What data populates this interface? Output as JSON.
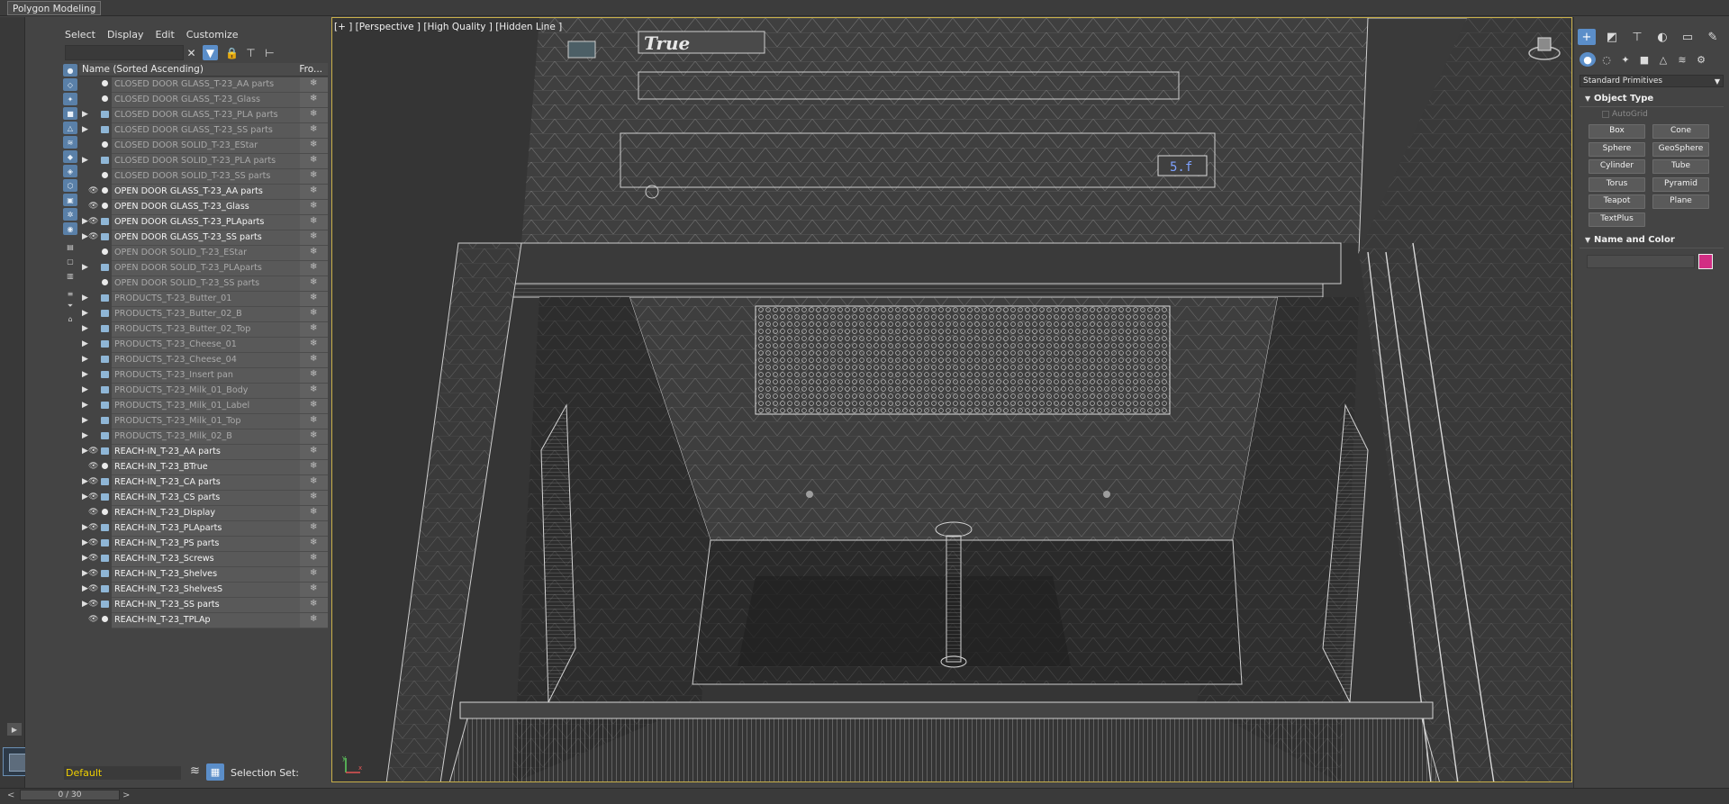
{
  "ribbon": {
    "active_tab": "Polygon Modeling"
  },
  "explorer": {
    "menu": [
      "Select",
      "Display",
      "Edit",
      "Customize"
    ],
    "header": {
      "name_col": "Name (Sorted Ascending)",
      "frozen_col": "Fro..."
    },
    "items": [
      {
        "label": "CLOSED DOOR GLASS_T-23_AA parts",
        "hidden": true,
        "group": false,
        "expand": false
      },
      {
        "label": "CLOSED DOOR GLASS_T-23_Glass",
        "hidden": true,
        "group": false,
        "expand": false
      },
      {
        "label": "CLOSED DOOR GLASS_T-23_PLA parts",
        "hidden": true,
        "group": true,
        "expand": true
      },
      {
        "label": "CLOSED DOOR GLASS_T-23_SS parts",
        "hidden": true,
        "group": true,
        "expand": true
      },
      {
        "label": "CLOSED DOOR SOLID_T-23_EStar",
        "hidden": true,
        "group": false,
        "expand": false
      },
      {
        "label": "CLOSED DOOR SOLID_T-23_PLA parts",
        "hidden": true,
        "group": true,
        "expand": true
      },
      {
        "label": "CLOSED DOOR SOLID_T-23_SS parts",
        "hidden": true,
        "group": false,
        "expand": false
      },
      {
        "label": "OPEN DOOR GLASS_T-23_AA parts",
        "hidden": false,
        "group": false,
        "expand": false
      },
      {
        "label": "OPEN DOOR GLASS_T-23_Glass",
        "hidden": false,
        "group": false,
        "expand": false
      },
      {
        "label": "OPEN DOOR GLASS_T-23_PLAparts",
        "hidden": false,
        "group": true,
        "expand": true
      },
      {
        "label": "OPEN DOOR GLASS_T-23_SS parts",
        "hidden": false,
        "group": true,
        "expand": true
      },
      {
        "label": "OPEN DOOR SOLID_T-23_EStar",
        "hidden": true,
        "group": false,
        "expand": false
      },
      {
        "label": "OPEN DOOR SOLID_T-23_PLAparts",
        "hidden": true,
        "group": true,
        "expand": true
      },
      {
        "label": "OPEN DOOR SOLID_T-23_SS parts",
        "hidden": true,
        "group": false,
        "expand": false
      },
      {
        "label": "PRODUCTS_T-23_Butter_01",
        "hidden": true,
        "group": true,
        "expand": true
      },
      {
        "label": "PRODUCTS_T-23_Butter_02_B",
        "hidden": true,
        "group": true,
        "expand": true
      },
      {
        "label": "PRODUCTS_T-23_Butter_02_Top",
        "hidden": true,
        "group": true,
        "expand": true
      },
      {
        "label": "PRODUCTS_T-23_Cheese_01",
        "hidden": true,
        "group": true,
        "expand": true
      },
      {
        "label": "PRODUCTS_T-23_Cheese_04",
        "hidden": true,
        "group": true,
        "expand": true
      },
      {
        "label": "PRODUCTS_T-23_Insert pan",
        "hidden": true,
        "group": true,
        "expand": true
      },
      {
        "label": "PRODUCTS_T-23_Milk_01_Body",
        "hidden": true,
        "group": true,
        "expand": true
      },
      {
        "label": "PRODUCTS_T-23_Milk_01_Label",
        "hidden": true,
        "group": true,
        "expand": true
      },
      {
        "label": "PRODUCTS_T-23_Milk_01_Top",
        "hidden": true,
        "group": true,
        "expand": true
      },
      {
        "label": "PRODUCTS_T-23_Milk_02_B",
        "hidden": true,
        "group": true,
        "expand": true
      },
      {
        "label": "REACH-IN_T-23_AA parts",
        "hidden": false,
        "group": true,
        "expand": true
      },
      {
        "label": "REACH-IN_T-23_BTrue",
        "hidden": false,
        "group": false,
        "expand": false
      },
      {
        "label": "REACH-IN_T-23_CA parts",
        "hidden": false,
        "group": true,
        "expand": true
      },
      {
        "label": "REACH-IN_T-23_CS parts",
        "hidden": false,
        "group": true,
        "expand": true
      },
      {
        "label": "REACH-IN_T-23_Display",
        "hidden": false,
        "group": false,
        "expand": false
      },
      {
        "label": "REACH-IN_T-23_PLAparts",
        "hidden": false,
        "group": true,
        "expand": true
      },
      {
        "label": "REACH-IN_T-23_PS parts",
        "hidden": false,
        "group": true,
        "expand": true
      },
      {
        "label": "REACH-IN_T-23_Screws",
        "hidden": false,
        "group": true,
        "expand": true
      },
      {
        "label": "REACH-IN_T-23_Shelves",
        "hidden": false,
        "group": true,
        "expand": true
      },
      {
        "label": "REACH-IN_T-23_ShelvesS",
        "hidden": false,
        "group": true,
        "expand": true
      },
      {
        "label": "REACH-IN_T-23_SS parts",
        "hidden": false,
        "group": true,
        "expand": true
      },
      {
        "label": "REACH-IN_T-23_TPLAp",
        "hidden": false,
        "group": false,
        "expand": false
      }
    ],
    "layer": "Default",
    "selection_set_label": "Selection Set:"
  },
  "timeline": {
    "value": "0 / 30",
    "prev": "<",
    "next": ">"
  },
  "viewport": {
    "label": "[+ ]  [Perspective ]  [High Quality ]  [Hidden Line ]",
    "brand_text": "True",
    "display_text": "5.f",
    "axis_labels": [
      "y",
      "x"
    ]
  },
  "command_panel": {
    "primitives_dropdown": "Standard Primitives",
    "object_type_title": "Object Type",
    "autogrid_label": "AutoGrid",
    "buttons": [
      "Box",
      "Cone",
      "Sphere",
      "GeoSphere",
      "Cylinder",
      "Tube",
      "Torus",
      "Pyramid",
      "Teapot",
      "Plane",
      "TextPlus"
    ],
    "name_color_title": "Name and Color",
    "object_color": "#d22e84"
  },
  "colors": {
    "accent": "#5b8ec9",
    "viewport_border": "#c9b04a",
    "layer_text": "#f0d000"
  }
}
